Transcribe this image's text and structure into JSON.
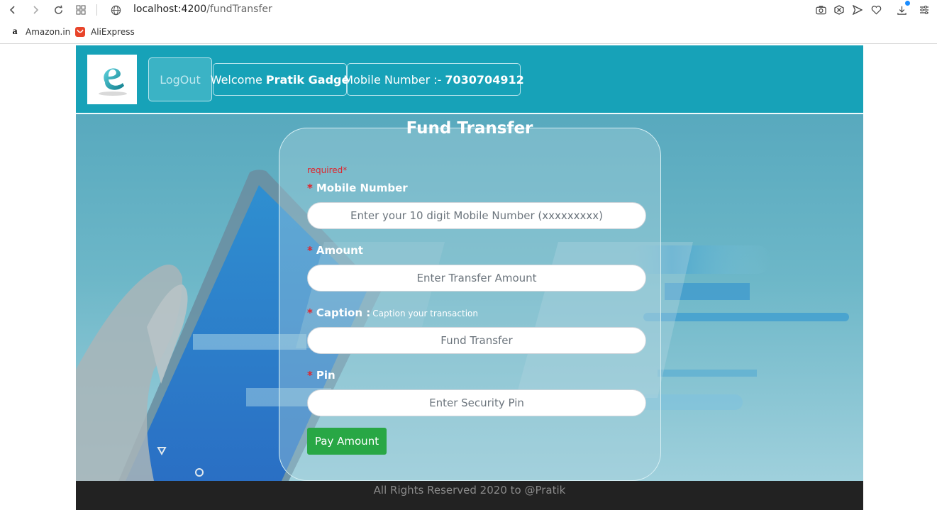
{
  "browser": {
    "url_host": "localhost:4200",
    "url_path": "/fundTransfer",
    "bookmarks": [
      {
        "label": "Amazon.in",
        "icon": "amazon-icon"
      },
      {
        "label": "AliExpress",
        "icon": "aliexpress-icon"
      }
    ]
  },
  "header": {
    "logout_label": "LogOut",
    "welcome_prefix": "Welcome",
    "user_name": "Pratik Gadge",
    "mobile_prefix": "Mobile Number :-",
    "mobile_number": "7030704912"
  },
  "form": {
    "title": "Fund Transfer",
    "required_note": "required*",
    "fields": [
      {
        "label": "Mobile Number",
        "hint": "",
        "placeholder": "Enter your 10 digit Mobile Number (xxxxxxxxx)"
      },
      {
        "label": "Amount",
        "hint": "",
        "placeholder": "Enter Transfer Amount"
      },
      {
        "label": "Caption :",
        "hint": "Caption your transaction",
        "placeholder": "Fund Transfer"
      },
      {
        "label": "Pin",
        "hint": "",
        "placeholder": "Enter Security Pin"
      }
    ],
    "star": "*",
    "submit_label": "Pay Amount"
  },
  "footer": {
    "text": "All Rights Reserved 2020 to @Pratik"
  },
  "colors": {
    "header_bg": "#17a2b8",
    "required": "#e0242c",
    "submit_bg": "#28a745",
    "footer_bg": "#222222"
  }
}
